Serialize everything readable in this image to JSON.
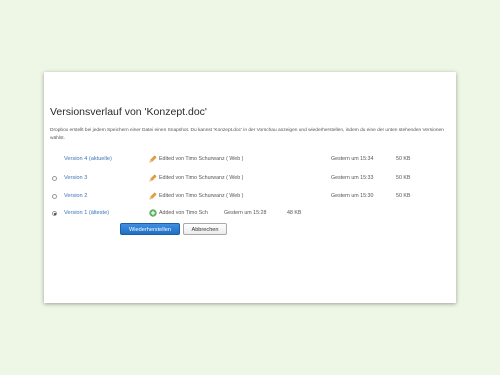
{
  "dialog": {
    "title": "Versionsverlauf von 'Konzept.doc'",
    "description": "Dropbox erstellt bei jedem Speichern einer Datei einen Snapshot. Du kannst 'Konzept.doc' in der Vorschau anzeigen und wiederherstellen, indem du eine der unten stehenden Versionen wählst.",
    "versions": [
      {
        "label": "Version 4 (aktuelle)",
        "editor": "Edited von Timo Schurwanz ( Web )",
        "time": "Gestern um 15:34",
        "size": "50 KB",
        "icon": "pencil-icon",
        "selected": false,
        "has_radio": false
      },
      {
        "label": "Version 3",
        "editor": "Edited von Timo Schurwanz ( Web )",
        "time": "Gestern um 15:33",
        "size": "50 KB",
        "icon": "pencil-icon",
        "selected": false,
        "has_radio": true
      },
      {
        "label": "Version 2",
        "editor": "Edited von Timo Schurwanz ( Web )",
        "time": "Gestern um 15:30",
        "size": "50 KB",
        "icon": "pencil-icon",
        "selected": false,
        "has_radio": true
      },
      {
        "label": "Version 1 (älteste)",
        "editor": "Added von Timo Sch",
        "time": "Gestern um 15:28",
        "size": "48 KB",
        "icon": "plus-circle-icon",
        "selected": true,
        "has_radio": true
      }
    ],
    "buttons": {
      "restore": "Wiederherstellen",
      "cancel": "Abbrechen"
    },
    "colors": {
      "link": "#3b73b9",
      "primary_button": "#2a7ed6",
      "added_icon": "#5cb85c",
      "edit_icon": "#f0a030"
    }
  }
}
